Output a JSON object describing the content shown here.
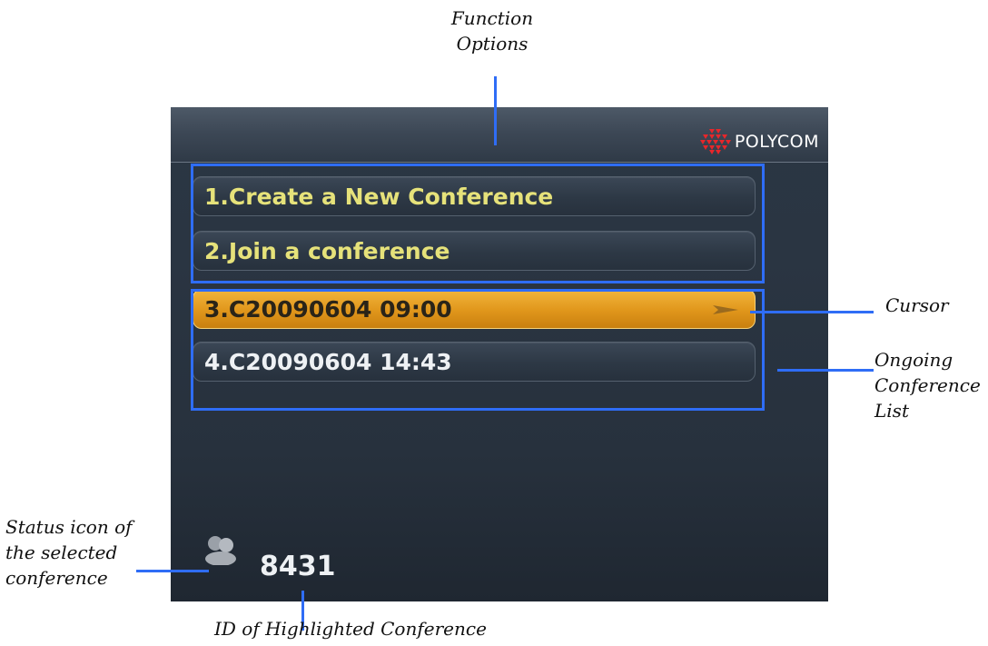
{
  "device": {
    "brand": "POLYCOM",
    "brand_color": "#e8262a",
    "menu": {
      "function_options": [
        {
          "label": "1.Create a New Conference"
        },
        {
          "label": "2.Join a conference"
        }
      ],
      "conferences": [
        {
          "label": "3.C20090604 09:00",
          "selected": true
        },
        {
          "label": "4.C20090604 14:43",
          "selected": false
        }
      ]
    },
    "status": {
      "icon": "people-icon",
      "conference_id": "8431"
    },
    "colors": {
      "function_text": "#e6e27a",
      "highlight": "#e8a124",
      "annotation": "#2f6df6"
    }
  },
  "annotations": {
    "function_options": [
      "Function",
      "Options"
    ],
    "cursor": "Cursor",
    "ongoing_list": [
      "Ongoing",
      "Conference",
      "List"
    ],
    "status_icon": [
      "Status icon of",
      "the selected",
      "conference"
    ],
    "highlighted_id": "ID of Highlighted Conference"
  }
}
